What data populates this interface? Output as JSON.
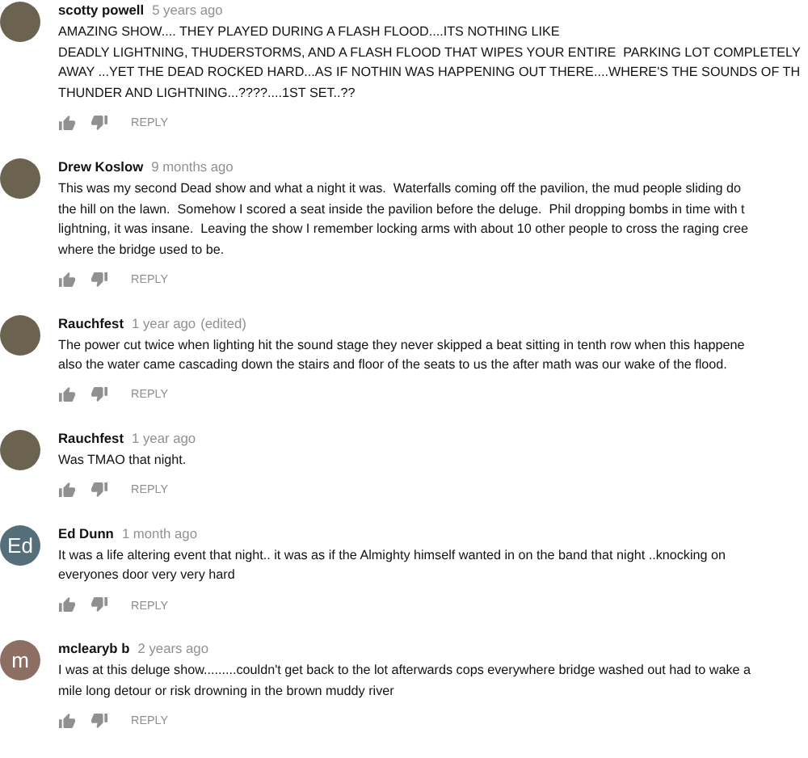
{
  "comments": [
    {
      "author": "scotty powell",
      "time": "5 years ago",
      "avatar": {
        "kind": "photo"
      },
      "lines": [
        "AMAZING SHOW.... THEY PLAYED DURING A FLASH FLOOD....ITS NOTHING LIKE",
        "DEADLY LIGHTNING, THUDERSTORMS, AND A FLASH FLOOD THAT WIPES YOUR ENTIRE  PARKING LOT COMPLETELY",
        "AWAY ...YET THE DEAD ROCKED HARD...AS IF NOTHIN WAS HAPPENING OUT THERE....WHERE'S THE SOUNDS OF TH",
        "THUNDER AND LIGHTNING...????....1ST SET..??"
      ],
      "reply": "REPLY"
    },
    {
      "author": "Drew Koslow",
      "time": "9 months ago",
      "avatar": {
        "kind": "photo"
      },
      "lines": [
        "This was my second Dead show and what a night it was.  Waterfalls coming off the pavilion, the mud people sliding do",
        "the hill on the lawn.  Somehow I scored a seat inside the pavilion before the deluge.  Phil dropping bombs in time with t",
        "lightning, it was insane.  Leaving the show I remember locking arms with about 10 other people to cross the raging cree",
        "where the bridge used to be."
      ],
      "reply": "REPLY"
    },
    {
      "author": "Rauchfest",
      "time": "1 year ago",
      "edited_note": "(edited)",
      "avatar": {
        "kind": "photo"
      },
      "lines": [
        "The power cut twice when lighting hit the sound stage they never skipped a beat sitting in tenth row when this happene",
        "also the water came cascading down the stairs and floor of the seats to us the after math was our wake of the flood."
      ],
      "reply": "REPLY"
    },
    {
      "author": "Rauchfest",
      "time": "1 year ago",
      "avatar": {
        "kind": "photo"
      },
      "lines": [
        "Was TMAO that night."
      ],
      "reply": "REPLY"
    },
    {
      "author": "Ed Dunn",
      "time": "1 month ago",
      "avatar": {
        "kind": "letter",
        "letter": "Ed",
        "color": "#546e7a"
      },
      "lines": [
        "It was a life altering event that night.. it was as if the Almighty himself wanted in on the band that night ..knocking on",
        "everyones door very very hard"
      ],
      "reply": "REPLY"
    },
    {
      "author": "mclearyb b",
      "time": "2 years ago",
      "avatar": {
        "kind": "letter",
        "letter": "m",
        "color": "#8d6e63"
      },
      "lines": [
        "I was at this deluge show.........couldn't get back to the lot afterwards cops everywhere bridge washed out had to wake a",
        "mile long detour or risk drowning in the brown muddy river"
      ],
      "reply": "REPLY"
    }
  ]
}
